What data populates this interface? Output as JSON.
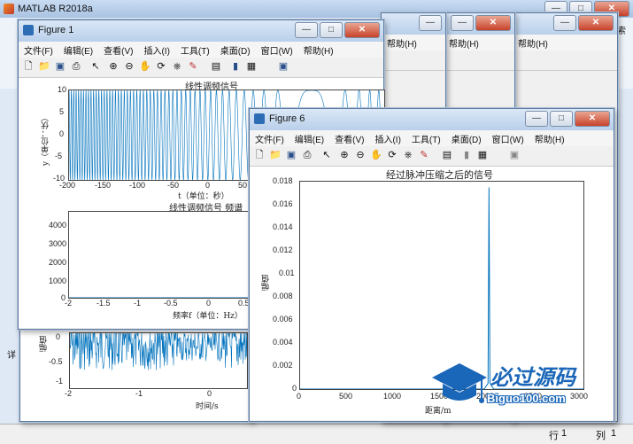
{
  "matlab": {
    "title": "MATLAB R2018a",
    "right_text": "索",
    "side_text": "详",
    "status": {
      "row_label": "行",
      "row_value": "1",
      "col_label": "列",
      "col_value": "1"
    }
  },
  "menu": [
    "文件(F)",
    "编辑(E)",
    "查看(V)",
    "插入(I)",
    "工具(T)",
    "桌面(D)",
    "窗口(W)",
    "帮助(H)"
  ],
  "icons": [
    "new-icon",
    "open-icon",
    "save-icon",
    "print-icon",
    "pointer-icon",
    "zoom-in-icon",
    "zoom-out-icon",
    "pan-icon",
    "rotate-icon",
    "datacursor-icon",
    "brush-icon",
    "link-icon",
    "colorbar-icon",
    "legend-icon",
    "plottools-icon"
  ],
  "colors": {
    "signal": "#0072bd",
    "titlebar": "#c5d9f1"
  },
  "fig1": {
    "title": "Figure 1",
    "top": {
      "title": "线性调频信号",
      "xlabel": "t（单位：秒）",
      "ylabel": "y（单位：伏）",
      "xticks": [
        "-200",
        "-150",
        "-100",
        "-50",
        "0",
        "50"
      ],
      "yticks": [
        "10",
        "5",
        "0",
        "-5",
        "-10"
      ]
    },
    "bottom": {
      "title": "线性调频信号  频谱",
      "xlabel": "频率f（单位：Hz）",
      "xticks": [
        "-2",
        "-1.5",
        "-1",
        "-0.5",
        "0",
        "0.5"
      ],
      "yticks": [
        "4000",
        "3000",
        "2000",
        "1000",
        "0"
      ]
    }
  },
  "fig_back": {
    "ylabel": "幅值",
    "xlabel": "时间/s",
    "xticks": [
      "-2",
      "-1",
      "0",
      "1"
    ],
    "yticks": [
      "0",
      "-0.5",
      "-1"
    ]
  },
  "fig6": {
    "title": "Figure 6",
    "plot_title": "经过脉冲压缩之后的信号",
    "xlabel": "距离/m",
    "ylabel": "幅值",
    "xticks": [
      "0",
      "500",
      "1000",
      "1500",
      "2000",
      "2500",
      "3000"
    ],
    "yticks": [
      "0.018",
      "0.016",
      "0.014",
      "0.012",
      "0.01",
      "0.008",
      "0.006",
      "0.004",
      "0.002",
      "0"
    ]
  },
  "chart_data": [
    {
      "type": "line",
      "title": "线性调频信号",
      "xlabel": "t（单位：秒）",
      "ylabel": "y（单位：伏）",
      "xlim": [
        -200,
        60
      ],
      "ylim": [
        -10,
        10
      ],
      "series": [
        {
          "values_description_free": true,
          "amplitude": 10,
          "pattern": "linear chirp oscillating between -10 and 10"
        }
      ]
    },
    {
      "type": "line",
      "title": "线性调频信号  频谱",
      "xlabel": "频率f（单位：Hz）",
      "xlim": [
        -2,
        0.6
      ],
      "ylim": [
        0,
        4500
      ],
      "x": [
        -2,
        -0.22,
        -0.2,
        -0.15,
        -0.1,
        0,
        0.1,
        0.15,
        0.2,
        0.22,
        0.6
      ],
      "y": [
        0,
        0,
        4200,
        3900,
        3800,
        3750,
        3800,
        3900,
        4200,
        0,
        0
      ]
    },
    {
      "type": "line",
      "title": "经过脉冲压缩之后的信号",
      "xlabel": "距离/m",
      "ylabel": "幅值",
      "xlim": [
        0,
        3000
      ],
      "ylim": [
        0,
        0.018
      ],
      "x": [
        0,
        1950,
        1990,
        2000,
        2010,
        2050,
        3000
      ],
      "y": [
        0,
        0,
        0.0005,
        0.0175,
        0.0005,
        0,
        0
      ]
    }
  ],
  "watermark": {
    "cn": "必过源码",
    "site": "Biguo100.com"
  }
}
